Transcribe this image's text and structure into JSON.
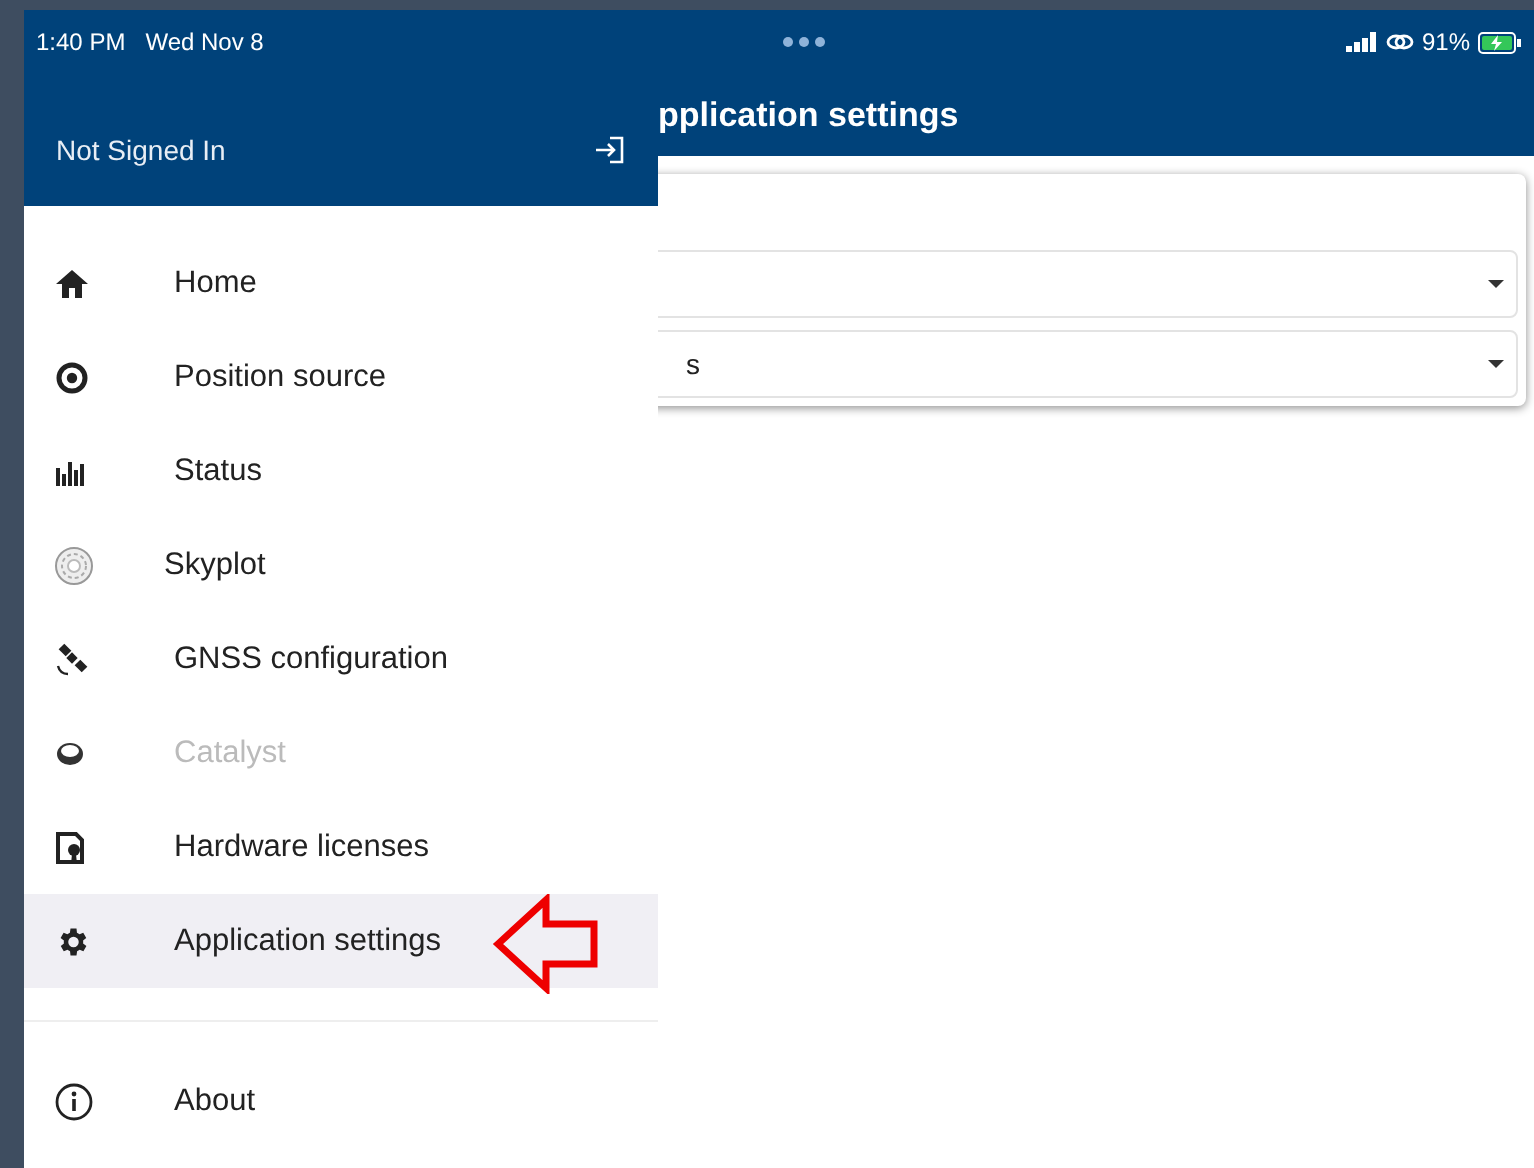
{
  "status_bar": {
    "time": "1:40 PM",
    "date": "Wed Nov 8",
    "battery": "91%"
  },
  "header": {
    "title": "pplication settings"
  },
  "settings_card": {
    "selects": [
      {
        "kind": "blank"
      },
      {
        "kind": "filled",
        "value": "s"
      }
    ]
  },
  "drawer": {
    "account": "Not Signed In",
    "items": [
      {
        "kind": "home",
        "label": "Home",
        "selected": false,
        "disabled": false
      },
      {
        "kind": "position",
        "label": "Position source",
        "selected": false,
        "disabled": false
      },
      {
        "kind": "status",
        "label": "Status",
        "selected": false,
        "disabled": false
      },
      {
        "kind": "skyplot",
        "label": "Skyplot",
        "selected": false,
        "disabled": false
      },
      {
        "kind": "gnss",
        "label": "GNSS configuration",
        "selected": false,
        "disabled": false
      },
      {
        "kind": "catalyst",
        "label": "Catalyst",
        "selected": false,
        "disabled": true
      },
      {
        "kind": "license",
        "label": "Hardware licenses",
        "selected": false,
        "disabled": false
      },
      {
        "kind": "settings",
        "label": "Application settings",
        "selected": true,
        "disabled": false
      }
    ],
    "footer_items": [
      {
        "kind": "about",
        "label": "About",
        "selected": false,
        "disabled": false
      }
    ]
  }
}
